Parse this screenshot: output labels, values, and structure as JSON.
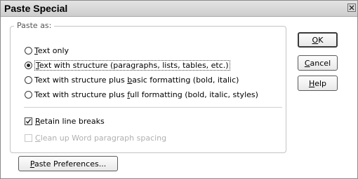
{
  "dialog": {
    "title": "Paste Special",
    "close_icon": "close-x-icon"
  },
  "paste_as": {
    "legend": "Paste as:",
    "options": [
      {
        "pre": "",
        "key": "T",
        "post": "ext only",
        "checked": false
      },
      {
        "pre": "",
        "key": "T",
        "post": "ext with structure (paragraphs, lists, tables, etc.)",
        "checked": true
      },
      {
        "pre": "Text with structure plus ",
        "key": "b",
        "post": "asic formatting (bold, italic)",
        "checked": false
      },
      {
        "pre": "Text with structure plus ",
        "key": "f",
        "post": "ull formatting (bold, italic, styles)",
        "checked": false
      }
    ],
    "retain_line_breaks": {
      "key": "R",
      "post": "etain line breaks",
      "checked": true
    },
    "clean_up_spacing": {
      "key": "C",
      "post": "lean up Word paragraph spacing",
      "checked": false,
      "disabled": true
    }
  },
  "buttons": {
    "ok": {
      "key": "O",
      "post": "K"
    },
    "cancel": {
      "key": "C",
      "post": "ancel"
    },
    "help": {
      "key": "H",
      "post": "elp"
    },
    "preferences": {
      "key": "P",
      "post": "aste Preferences..."
    }
  }
}
